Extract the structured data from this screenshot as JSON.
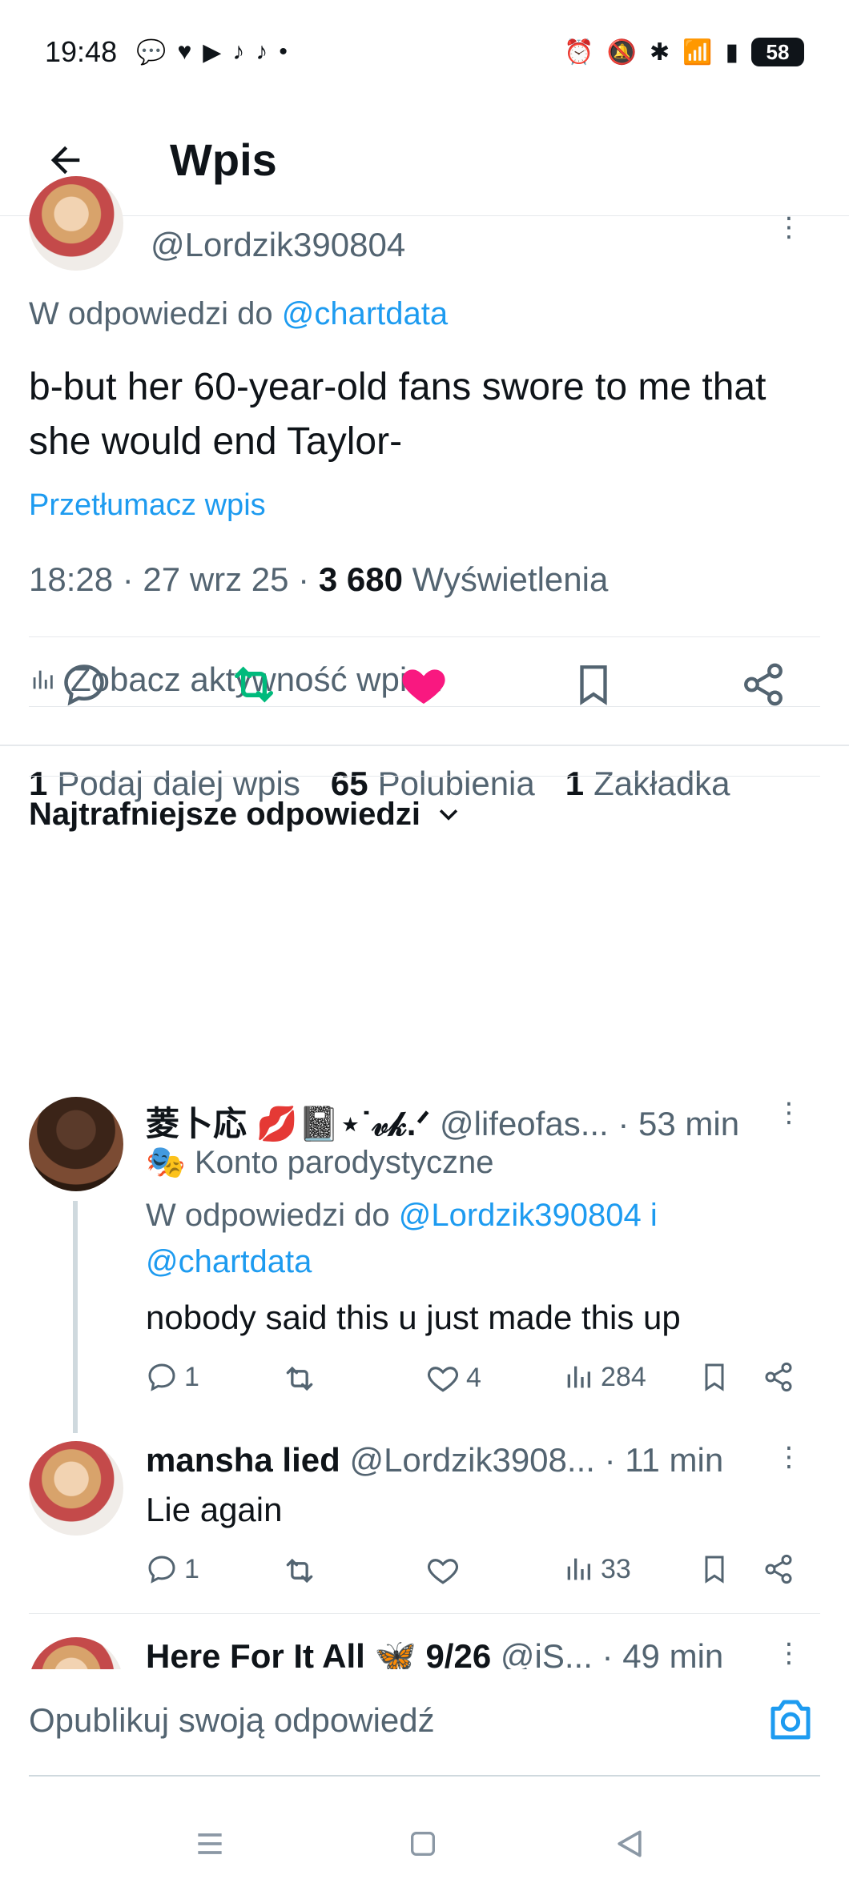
{
  "status_bar": {
    "time": "19:48",
    "battery": "58"
  },
  "header": {
    "title": "Wpis"
  },
  "post": {
    "handle": "@Lordzik390804",
    "reply_prefix": "W odpowiedzi do",
    "reply_to": "@chartdata",
    "text": "b-but her 60-year-old fans swore to me that she would end Taylor-",
    "translate": "Przetłumacz wpis",
    "time": "18:28 · 27 wrz 25 · ",
    "views_count": "3 680",
    "views_label": "Wyświetlenia",
    "activity": "Zobacz aktywność wpisu",
    "reposts_count": "1",
    "reposts_label": "Podaj dalej wpis",
    "likes_count": "65",
    "likes_label": "Polubienia",
    "bookmarks_count": "1",
    "bookmarks_label": "Zakładka"
  },
  "replies_sort": "Najtrafniejsze odpowiedzi",
  "replies": [
    {
      "name": "菱卜応 💋📓⋆˙𝓋𝓀.ᐟ",
      "handle": "@lifeofas...",
      "time": "· 53 min",
      "badge": "Konto parodystyczne",
      "reply_prefix": "W odpowiedzi do",
      "reply_to_1": "@Lordzik390804 i",
      "reply_to_2": "@chartdata",
      "text": "nobody said this u just made this up",
      "comments": "1",
      "likes": "4",
      "views": "284"
    },
    {
      "name": "mansha lied",
      "handle": "@Lordzik3908...",
      "time": "· 11 min",
      "text": "Lie again",
      "comments": "1",
      "views": "33"
    },
    {
      "name": "Here For It All 🦋 9/26",
      "handle": "@iS...",
      "time": "· 49 min"
    }
  ],
  "composer": {
    "placeholder": "Opublikuj swoją odpowiedź"
  },
  "colors": {
    "accent": "#1d9bf0",
    "like": "#f91880",
    "repost": "#00ba7c",
    "muted": "#536471"
  }
}
